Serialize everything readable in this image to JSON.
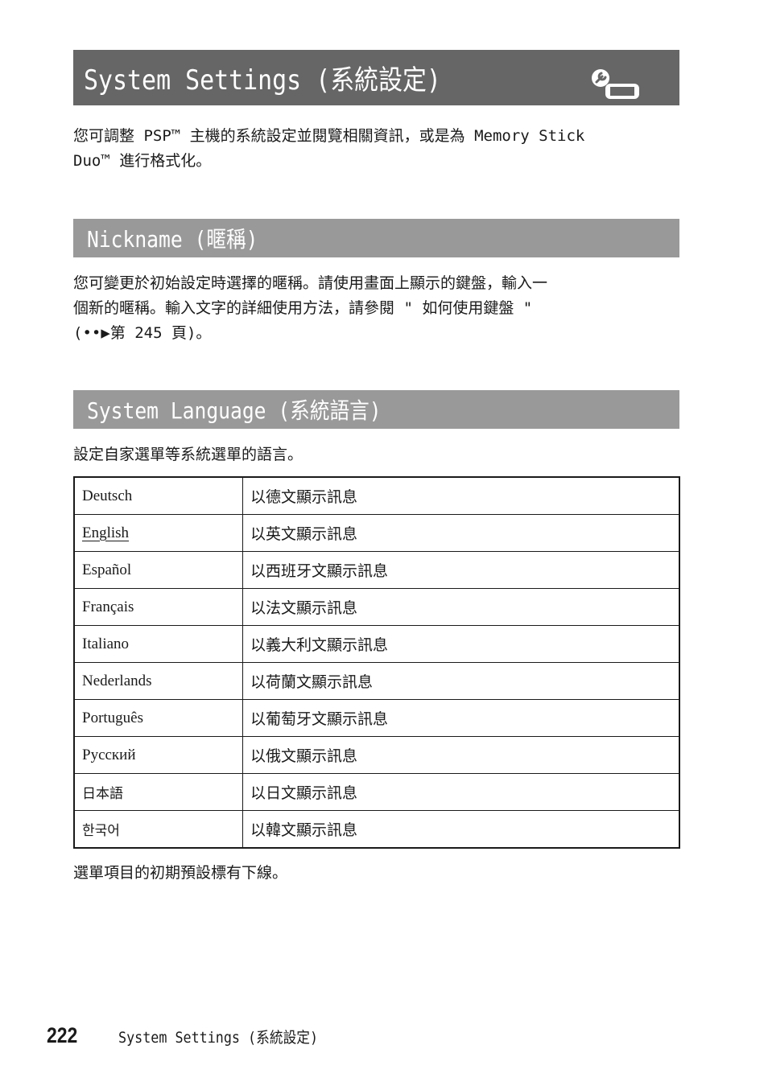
{
  "page": {
    "title": "System Settings (系統設定)",
    "title_icon": "settings-wrench-psp-icon",
    "intro": [
      "您可調整 PSP™ 主機的系統設定並閱覽相關資訊，或是為 Memory Stick",
      "Duo™ 進行格式化。"
    ]
  },
  "sections": {
    "nickname": {
      "title": "Nickname (暱稱)",
      "body": [
        "您可變更於初始設定時選擇的暱稱。請使用畫面上顯示的鍵盤，輸入一",
        "個新的暱稱。輸入文字的詳細使用方法，請參閱 \" 如何使用鍵盤 \"",
        "(••▶第 245 頁)。"
      ]
    },
    "language": {
      "title": "System Language (系統語言)",
      "body": "設定自家選單等系統選單的語言。",
      "rows": [
        {
          "language": "Deutsch",
          "description": "以德文顯示訊息",
          "default": false
        },
        {
          "language": "English",
          "description": "以英文顯示訊息",
          "default": true
        },
        {
          "language": "Español",
          "description": "以西班牙文顯示訊息",
          "default": false
        },
        {
          "language": "Français",
          "description": "以法文顯示訊息",
          "default": false
        },
        {
          "language": "Italiano",
          "description": "以義大利文顯示訊息",
          "default": false
        },
        {
          "language": "Nederlands",
          "description": "以荷蘭文顯示訊息",
          "default": false
        },
        {
          "language": "Português",
          "description": "以葡萄牙文顯示訊息",
          "default": false
        },
        {
          "language": "Русский",
          "description": "以俄文顯示訊息",
          "default": false
        },
        {
          "language": "日本語",
          "description": "以日文顯示訊息",
          "default": false
        },
        {
          "language": "한국어",
          "description": "以韓文顯示訊息",
          "default": false
        }
      ],
      "note": "選單項目的初期預設標有下線。"
    }
  },
  "footer": {
    "page_number": "222",
    "section_title": "System Settings (系統設定)"
  }
}
